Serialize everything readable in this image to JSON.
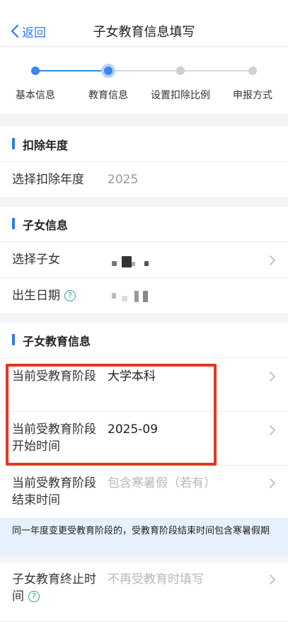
{
  "nav": {
    "back_label": "返回",
    "title": "子女教育信息填写"
  },
  "steps": [
    {
      "label": "基本信息",
      "state": "done"
    },
    {
      "label": "教育信息",
      "state": "current"
    },
    {
      "label": "设置扣除比例",
      "state": "todo"
    },
    {
      "label": "申报方式",
      "state": "todo"
    }
  ],
  "colors": {
    "accent": "#2f7be6",
    "highlight": "#e8351c",
    "help": "#2fa38b"
  },
  "deduction_year": {
    "section_title": "扣除年度",
    "label": "选择扣除年度",
    "value": "2025"
  },
  "child_info": {
    "section_title": "子女信息",
    "select_child_label": "选择子女",
    "birth_date_label": "出生日期"
  },
  "education_info": {
    "section_title": "子女教育信息",
    "rows": [
      {
        "label": "当前受教育阶段",
        "value": "大学本科",
        "placeholder": false
      },
      {
        "label": "当前受教育阶段开始时间",
        "value": "2025-09",
        "placeholder": false
      },
      {
        "label": "当前受教育阶段结束时间",
        "value": "包含寒暑假（若有）",
        "placeholder": true
      }
    ],
    "notice": "同一年度变更受教育阶段的，受教育阶段结束时间包含寒暑假期",
    "end_row": {
      "label": "子女教育终止时间",
      "value": "不再受教育时填写",
      "placeholder": true
    }
  }
}
